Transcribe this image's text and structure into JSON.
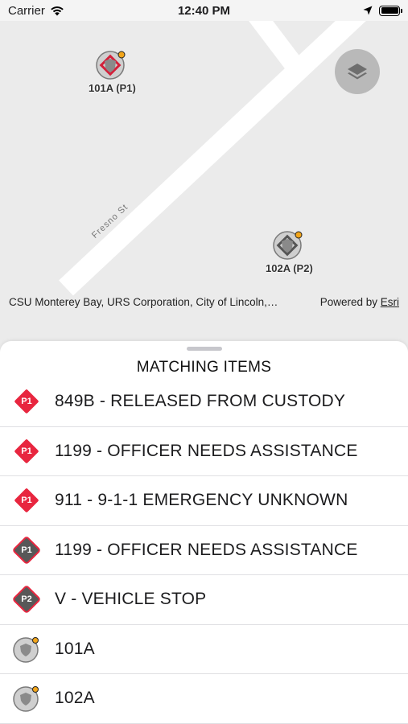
{
  "status_bar": {
    "carrier": "Carrier",
    "time": "12:40 PM"
  },
  "map": {
    "street_label": "Fresno St",
    "layers_button": "layers-icon",
    "markers": [
      {
        "label": "101A (P1)"
      },
      {
        "label": "102A (P2)"
      }
    ],
    "attribution": "CSU Monterey Bay, URS Corporation, City of Lincoln,…",
    "powered_by": "Powered by",
    "powered_link": "Esri"
  },
  "sheet": {
    "title": "MATCHING ITEMS",
    "items": [
      {
        "label": "849B - RELEASED FROM CUSTODY",
        "icon": "incident-priority-icon",
        "badge": "P1",
        "color": "#e8263f"
      },
      {
        "label": "1199 - OFFICER NEEDS ASSISTANCE",
        "icon": "incident-priority-icon",
        "badge": "P1",
        "color": "#e8263f"
      },
      {
        "label": "911 - 9-1-1 EMERGENCY UNKNOWN",
        "icon": "incident-priority-icon",
        "badge": "P1",
        "color": "#e8263f"
      },
      {
        "label": "1199 - OFFICER NEEDS ASSISTANCE",
        "icon": "incident-assigned-icon",
        "badge": "P1",
        "color": "#585858"
      },
      {
        "label": "V - VEHICLE STOP",
        "icon": "incident-assigned-icon",
        "badge": "P2",
        "color": "#585858"
      },
      {
        "label": "101A",
        "icon": "unit-shield-icon",
        "badge": "",
        "color": "#bdbdbd"
      },
      {
        "label": "102A",
        "icon": "unit-shield-icon",
        "badge": "",
        "color": "#bdbdbd"
      }
    ]
  },
  "colors": {
    "priority_red": "#e8263f",
    "assigned_gray": "#585858",
    "unit_status_dot": "#f2a51a",
    "map_background": "#ebebeb"
  }
}
